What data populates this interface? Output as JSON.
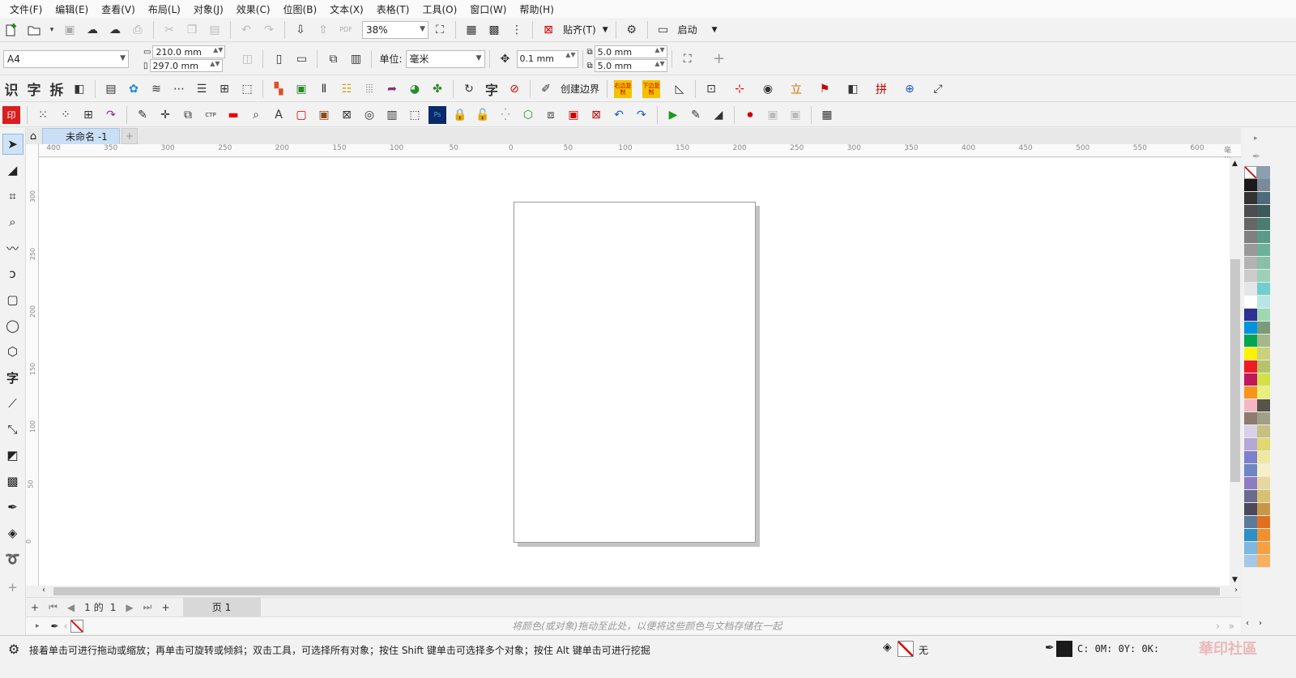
{
  "menu": [
    "文件(F)",
    "编辑(E)",
    "查看(V)",
    "布局(L)",
    "对象(J)",
    "效果(C)",
    "位图(B)",
    "文本(X)",
    "表格(T)",
    "工具(O)",
    "窗口(W)",
    "帮助(H)"
  ],
  "toolbar1": {
    "zoom": "38%",
    "snap_label": "贴齐(T)",
    "launch_label": "启动"
  },
  "toolbar2": {
    "page_size": "A4",
    "width": "210.0 mm",
    "height": "297.0 mm",
    "unit_label": "单位:",
    "unit_value": "毫米",
    "nudge": "0.1 mm",
    "dup_x": "5.0 mm",
    "dup_y": "5.0 mm"
  },
  "toolbar3": {
    "chars": [
      "识",
      "字",
      "拆"
    ],
    "create_boundary": "创建边界",
    "right_copy": "右边复制",
    "bottom_copy": "下边复制",
    "char_zi": "字"
  },
  "tabs": {
    "doc_title": "未命名 -1"
  },
  "ruler": {
    "h_ticks": [
      "400",
      "350",
      "300",
      "250",
      "200",
      "150",
      "100",
      "50",
      "0",
      "50",
      "100",
      "150",
      "200",
      "250",
      "300",
      "350",
      "400",
      "450",
      "500",
      "550",
      "600"
    ],
    "h_unit": "毫米",
    "v_ticks": [
      "300",
      "250",
      "200",
      "150",
      "100",
      "50",
      "0"
    ]
  },
  "pagebar": {
    "current": "1",
    "of": "的",
    "total": "1",
    "page_tab": "页 1"
  },
  "docpalette": {
    "hint": "将颜色(或对象)拖动至此处，以便将这些颜色与文档存储在一起"
  },
  "status": {
    "message": "接着单击可进行拖动或缩放；再单击可旋转或倾斜；双击工具，可选择所有对象；按住 Shift 键单击可选择多个对象；按住 Alt 键单击可进行挖掘",
    "fill_label": "无",
    "cmyk": "C: 0M: 0Y: 0K:",
    "watermark": "華印社區"
  },
  "palette": {
    "col1": [
      "#1a1a1a",
      "#333333",
      "#4d4d4d",
      "#666666",
      "#808080",
      "#999999",
      "#b3b3b3",
      "#cccccc",
      "#e6e6e6",
      "#ffffff",
      "#2e3192",
      "#0093dd",
      "#00a651",
      "#fff200",
      "#ed1c24",
      "#c2185b",
      "#f7941d",
      "#f4b6c2",
      "#8c7b6e",
      "#d9d1e8",
      "#b3a9d6",
      "#7f7fcf",
      "#6e86c4",
      "#8e7cc3",
      "#6b6b8e",
      "#4a4a5a",
      "#5e7a9a",
      "#2c8fc8",
      "#7bb9e2",
      "#a3c8e8"
    ],
    "col2": [
      "#7a8a9a",
      "#4e6b78",
      "#3c5a5a",
      "#4a7d72",
      "#5a9a8a",
      "#6fb09a",
      "#86c0a8",
      "#9fd0b8",
      "#6fcfcf",
      "#b8e6e6",
      "#9fd8b0",
      "#7a9a7a",
      "#a5b88a",
      "#c8d27a",
      "#b5c46a",
      "#d4e04a",
      "#e8f07a",
      "#56534a",
      "#a0a088",
      "#c8c080",
      "#e0d870",
      "#f0e8a0",
      "#f5f0c8",
      "#e8d8a0",
      "#d8c070",
      "#c89848",
      "#e07020",
      "#f09030",
      "#f5a040",
      "#f8b060"
    ]
  }
}
